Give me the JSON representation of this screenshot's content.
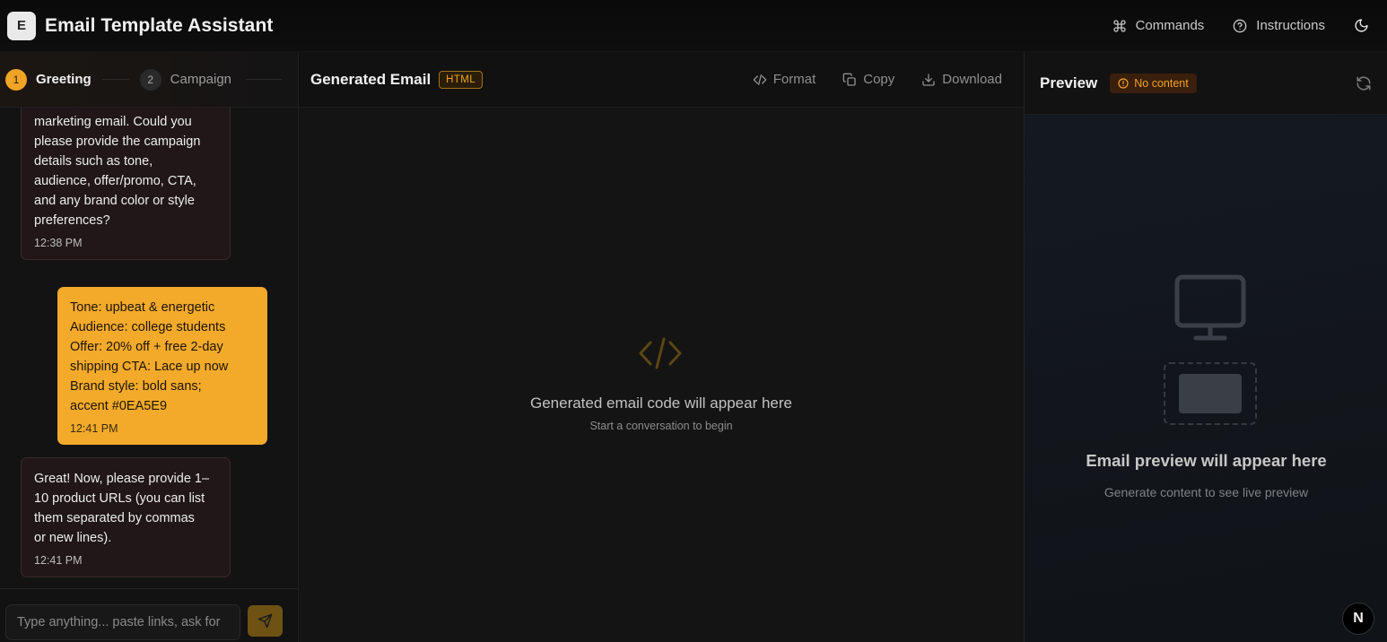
{
  "app": {
    "logo_letter": "E",
    "title": "Email Template Assistant"
  },
  "top_actions": {
    "commands": "Commands",
    "instructions": "Instructions"
  },
  "steps": [
    {
      "num": "1",
      "label": "Greeting",
      "active": true
    },
    {
      "num": "2",
      "label": "Campaign",
      "active": false
    }
  ],
  "messages": [
    {
      "role": "assistant",
      "text": "marketing email. Could you\nplease provide the campaign\ndetails such as tone,\naudience, offer/promo, CTA,\nand any brand color or style\npreferences?",
      "time": "12:38 PM"
    },
    {
      "role": "user",
      "text": "Tone: upbeat & energetic\nAudience: college students\nOffer: 20% off + free 2-day\nshipping CTA: Lace up now\nBrand style: bold sans;\naccent #0EA5E9",
      "time": "12:41 PM"
    },
    {
      "role": "assistant",
      "text": "Great! Now, please provide 1–\n10 product URLs (you can list\nthem separated by commas\nor new lines).",
      "time": "12:41 PM"
    }
  ],
  "composer": {
    "placeholder": "Type anything... paste links, ask for"
  },
  "editor": {
    "title": "Generated Email",
    "badge": "HTML",
    "actions": {
      "format": "Format",
      "copy": "Copy",
      "download": "Download"
    },
    "empty_title": "Generated email code will appear here",
    "empty_sub": "Start a conversation to begin"
  },
  "preview": {
    "title": "Preview",
    "badge": "No content",
    "empty_title": "Email preview will appear here",
    "empty_sub": "Generate content to see live preview"
  },
  "corner_badge": "N",
  "colors": {
    "accent": "#f0a424",
    "user_bubble": "#f3aa2a",
    "bot_bubble": "#211718"
  }
}
